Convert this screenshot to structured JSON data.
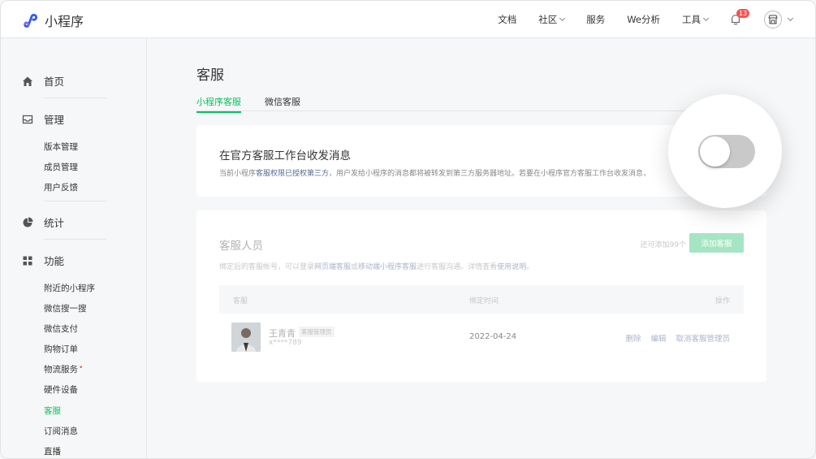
{
  "app": {
    "name": "小程序"
  },
  "topnav": {
    "items": [
      "文档",
      "社区",
      "服务",
      "We分析",
      "工具"
    ],
    "notification_count": "13"
  },
  "sidebar": {
    "home": "首页",
    "manage": {
      "label": "管理",
      "items": [
        "版本管理",
        "成员管理",
        "用户反馈"
      ]
    },
    "stats": "统计",
    "features": {
      "label": "功能",
      "items": [
        "附近的小程序",
        "微信搜一搜",
        "微信支付",
        "购物订单",
        "物流服务",
        "硬件设备",
        "客服",
        "订阅消息",
        "直播"
      ]
    },
    "active_item": "客服"
  },
  "main": {
    "title": "客服",
    "tabs": [
      "小程序客服",
      "微信客服"
    ],
    "active_tab": "小程序客服",
    "official": {
      "title": "在官方客服工作台收发消息",
      "desc_prefix": "当前小程序",
      "desc_link": "客服权限已授权第三方",
      "desc_suffix": "，用户发给小程序的消息都将被转发到第三方服务器地址。若要在小程序官方客服工作台收发消息，",
      "toggle_on": false
    },
    "agents": {
      "title": "客服人员",
      "count_text": "还可添加99个",
      "add_button": "添加客服",
      "desc_prefix": "绑定后的客服帐号，可以登录",
      "desc_link1": "网页端客服",
      "desc_mid": "或",
      "desc_link2": "移动端小程序客服",
      "desc_mid2": "进行客服沟通。详情查看",
      "desc_link3": "使用说明",
      "desc_suffix": "。",
      "columns": [
        "客服",
        "绑定时间",
        "操作"
      ],
      "rows": [
        {
          "name": "王青青",
          "role": "客服管理员",
          "id": "x****789",
          "date": "2022-04-24",
          "actions": [
            "删除",
            "编辑",
            "取消客服管理员"
          ]
        }
      ]
    }
  },
  "colors": {
    "accent": "#07c160",
    "link": "#576b95",
    "danger": "#fa5151"
  }
}
